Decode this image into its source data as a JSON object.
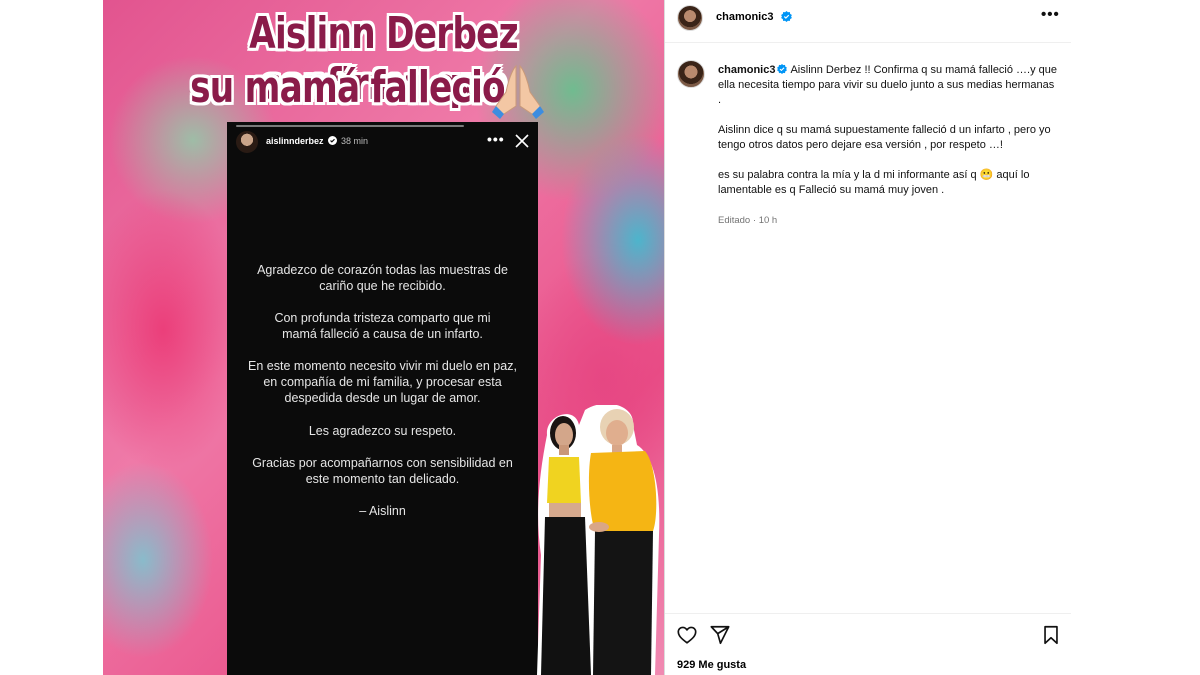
{
  "image": {
    "headline_line1": "Aislinn Derbez confirma que",
    "headline_line2": "su mamá falleció",
    "story": {
      "username": "aislinnderbez",
      "time": "38 min",
      "paragraphs": [
        "Agradezco de corazón todas las muestras de cariño que he recibido.",
        "Con profunda tristeza comparto que mi mamá falleció a causa de un infarto.",
        "En este momento necesito vivir mi duelo en paz, en compañía de mi familia, y procesar esta despedida desde un lugar de amor.",
        "Les agradezco su respeto.",
        "Gracias por acompañarnos con sensibilidad en este momento tan delicado.",
        "– Aislinn"
      ]
    }
  },
  "post": {
    "username": "chamonic3",
    "caption_text_1": "Aislinn Derbez !! Confirma q su mamá falleció ….y que ella necesita tiempo para vivir su duelo junto a sus medias hermanas .",
    "caption_text_2": "Aislinn dice q su mamá supuestamente falleció d un infarto , pero yo tengo otros datos pero dejare esa versión , por respeto …!",
    "caption_text_3": "es su palabra contra la mía y la d mi informante así q 😬 aquí lo lamentable es q Falleció su mamá muy joven .",
    "edited_label": "Editado",
    "edited_time": "10 h",
    "likes": "929 Me gusta"
  },
  "icons": {
    "more": "more-icon",
    "like": "heart-icon",
    "share": "share-icon",
    "save": "bookmark-icon",
    "verified": "verified-badge-icon"
  },
  "colors": {
    "verified": "#0095f6",
    "headline": "#8a1b49",
    "muted": "#737373"
  }
}
